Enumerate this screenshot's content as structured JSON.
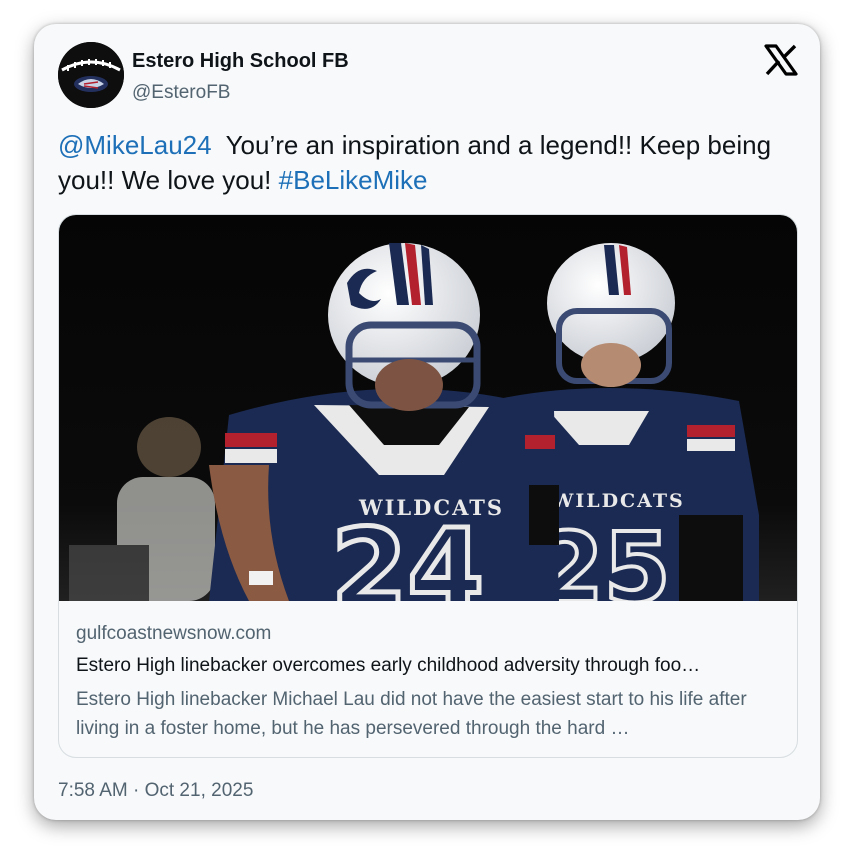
{
  "account": {
    "name": "Estero High School FB",
    "handle": "@EsteroFB"
  },
  "tweet": {
    "mention": "@MikeLau24",
    "text_main": "You’re an inspiration and a legend!! Keep being you!! We love you!",
    "hashtag": "#BeLikeMike"
  },
  "link_card": {
    "domain": "gulfcoastnewsnow.com",
    "title": "Estero High linebacker overcomes early childhood adversity through foo…",
    "description": "Estero High linebacker Michael Lau did not have the easiest start to his life after living in a foster home, but he has persevered through the hard …",
    "jersey_text": "WILDCATS",
    "jersey_numbers": [
      "24",
      "25"
    ]
  },
  "timestamp": "7:58 AM · Oct 21, 2025",
  "colors": {
    "link": "#1d70b8",
    "navy_jersey": "#1b2a52",
    "helmet_stripe_red": "#b3202e"
  },
  "icons": {
    "brand": "x-logo-icon",
    "avatar": "wildcat-football-logo"
  }
}
